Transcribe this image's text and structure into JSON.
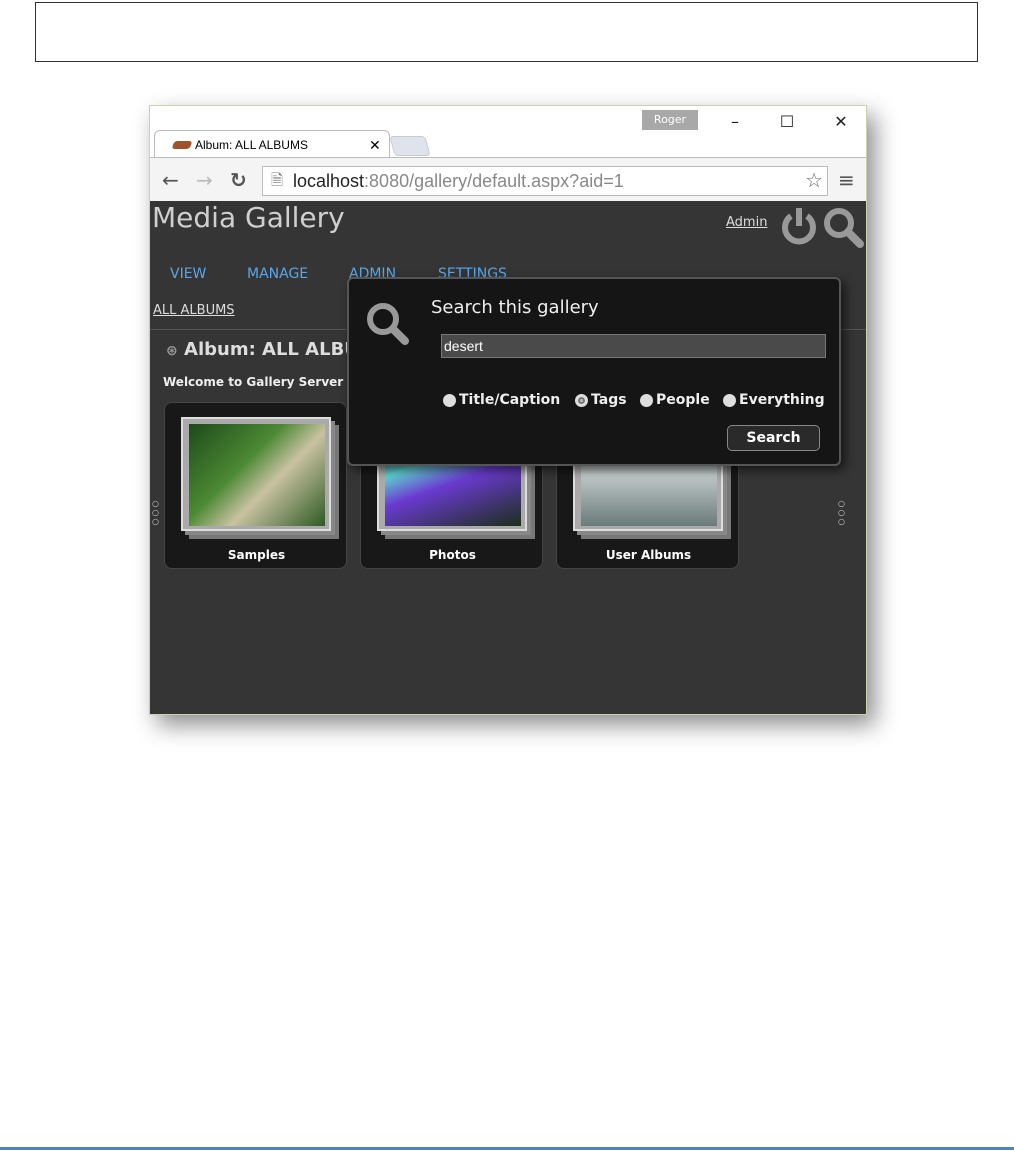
{
  "browser": {
    "profile": "Roger",
    "tab_title": "Album: ALL ALBUMS",
    "url_host": "localhost",
    "url_rest": ":8080/gallery/default.aspx?aid=1"
  },
  "header": {
    "title": "Media Gallery",
    "admin_link": "Admin"
  },
  "menu": [
    "VIEW",
    "MANAGE",
    "ADMIN",
    "SETTINGS"
  ],
  "breadcrumb": "ALL ALBUMS",
  "album": {
    "title": "Album: ALL ALBUMS",
    "welcome": "Welcome to Gallery Server"
  },
  "albums": [
    {
      "caption": "Samples"
    },
    {
      "caption": "Photos"
    },
    {
      "caption": "User Albums"
    }
  ],
  "search_popup": {
    "title": "Search this gallery",
    "query": "desert",
    "options": [
      "Title/Caption",
      "Tags",
      "People",
      "Everything"
    ],
    "selected": "Tags",
    "button": "Search"
  }
}
